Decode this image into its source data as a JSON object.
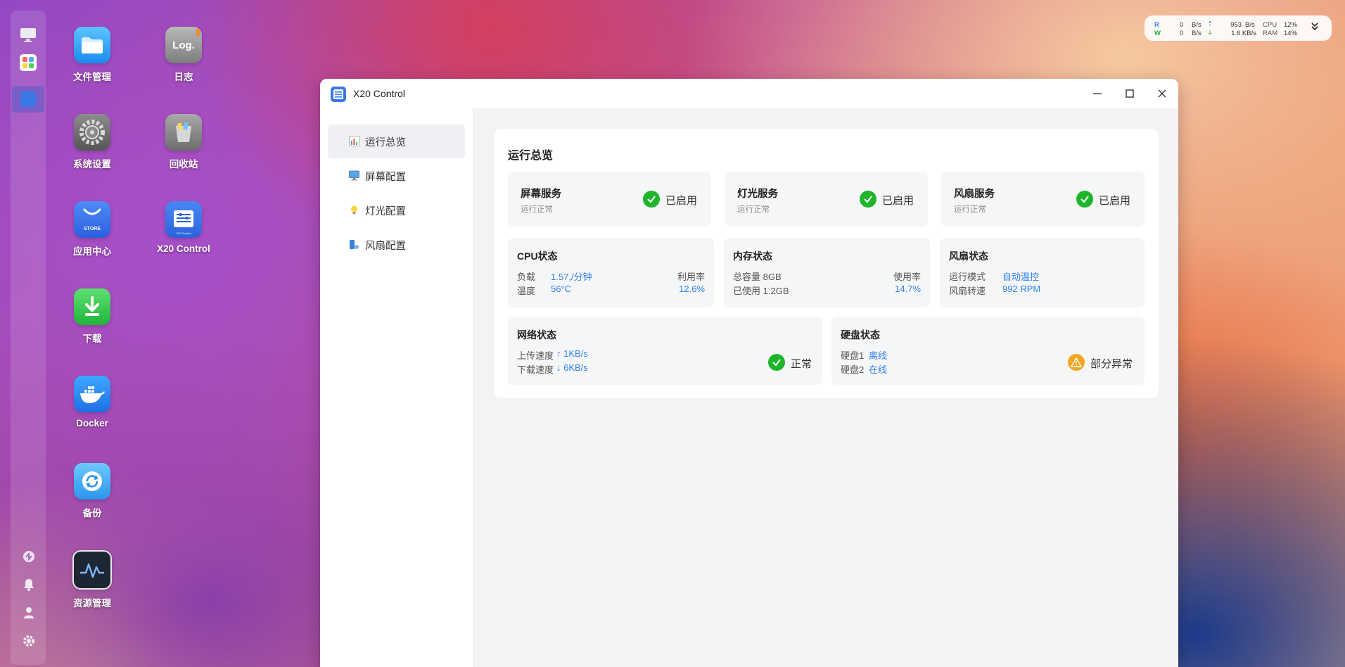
{
  "system_widget": {
    "read_label": "R",
    "write_label": "W",
    "read_rate": "0",
    "read_unit": "B/s",
    "write_rate": "0",
    "write_unit": "B/s",
    "up_rate": "953",
    "up_unit": "B/s",
    "down_rate": "1.6 KB/s",
    "cpu_label": "CPU",
    "cpu_value": "12%",
    "ram_label": "RAM",
    "ram_value": "14%"
  },
  "desktop": {
    "icons": [
      {
        "label": "文件管理"
      },
      {
        "label": "日志",
        "glyph": "Log."
      },
      {
        "label": "系统设置"
      },
      {
        "label": "回收站"
      },
      {
        "label": "应用中心",
        "glyph": "STORE"
      },
      {
        "label": "X20 Control",
        "glyph": "X20 Control"
      },
      {
        "label": "下载"
      },
      {
        "label": "Docker"
      },
      {
        "label": "备份"
      },
      {
        "label": "资源管理"
      }
    ]
  },
  "window": {
    "title": "X20 Control",
    "nav": [
      {
        "label": "运行总览"
      },
      {
        "label": "屏幕配置"
      },
      {
        "label": "灯光配置"
      },
      {
        "label": "风扇配置"
      }
    ],
    "panel_title": "运行总览",
    "services": [
      {
        "name": "屏幕服务",
        "sub": "运行正常",
        "status": "已启用"
      },
      {
        "name": "灯光服务",
        "sub": "运行正常",
        "status": "已启用"
      },
      {
        "name": "风扇服务",
        "sub": "运行正常",
        "status": "已启用"
      }
    ],
    "cpu": {
      "title": "CPU状态",
      "load_label": "负载",
      "load_value": "1.57,/分钟",
      "util_label": "利用率",
      "temp_label": "温度",
      "temp_value": "56°C",
      "util_value": "12.6%"
    },
    "memory": {
      "title": "内存状态",
      "total_label": "总容量",
      "total_value": "8GB",
      "used_label": "已使用",
      "used_value": "1.2GB",
      "usage_label": "使用率",
      "usage_value": "14.7%"
    },
    "fan": {
      "title": "风扇状态",
      "mode_label": "运行模式",
      "mode_value": "自动温控",
      "speed_label": "风扇转速",
      "speed_value": "992 RPM"
    },
    "network": {
      "title": "网络状态",
      "up_label": "上传速度",
      "up_value": "↑ 1KB/s",
      "down_label": "下载速度",
      "down_value": "↓ 6KB/s",
      "status": "正常"
    },
    "disk": {
      "title": "硬盘状态",
      "d1_label": "硬盘1",
      "d1_value": "离线",
      "d2_label": "硬盘2",
      "d2_value": "在线",
      "status": "部分异常"
    }
  },
  "colors": {
    "accent": "#2f80ed",
    "ok": "#1fb52a",
    "warn": "#f4a521"
  }
}
